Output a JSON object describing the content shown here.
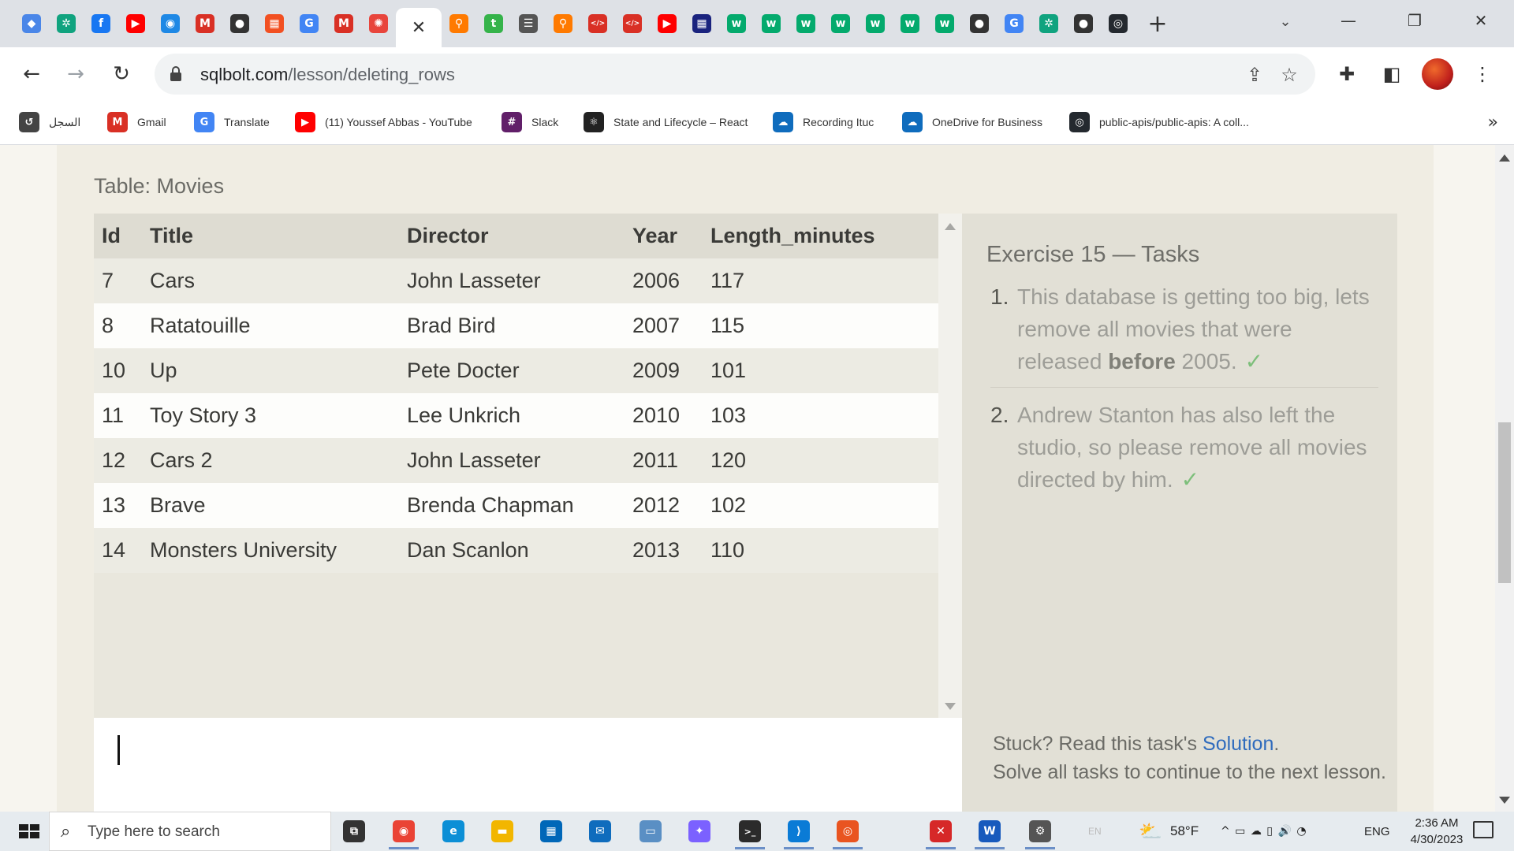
{
  "browser": {
    "tabs": [
      {
        "name": "tab-favicon-1",
        "glyph": "◆",
        "color": "#4a86e8"
      },
      {
        "name": "tab-favicon-2",
        "glyph": "✲",
        "color": "#10a37f"
      },
      {
        "name": "tab-favicon-3",
        "glyph": "f",
        "color": "#1877f2"
      },
      {
        "name": "tab-favicon-4",
        "glyph": "▶",
        "color": "#ff0000"
      },
      {
        "name": "tab-favicon-5",
        "glyph": "◉",
        "color": "#1e88e5"
      },
      {
        "name": "tab-favicon-6",
        "glyph": "M",
        "color": "#d93025"
      },
      {
        "name": "tab-favicon-7",
        "glyph": "●",
        "color": "#333333"
      },
      {
        "name": "tab-favicon-8",
        "glyph": "▦",
        "color": "#f25022"
      },
      {
        "name": "tab-favicon-9",
        "glyph": "G",
        "color": "#4285f4"
      },
      {
        "name": "tab-favicon-10",
        "glyph": "M",
        "color": "#d93025"
      },
      {
        "name": "tab-favicon-11",
        "glyph": "✺",
        "color": "#e8453c"
      },
      {
        "name": "tab-favicon-13",
        "glyph": "⚲",
        "color": "#ff7a00"
      },
      {
        "name": "tab-favicon-14",
        "glyph": "t",
        "color": "#35b34a"
      },
      {
        "name": "tab-favicon-15",
        "glyph": "☰",
        "color": "#555555"
      },
      {
        "name": "tab-favicon-16",
        "glyph": "⚲",
        "color": "#ff7a00"
      },
      {
        "name": "tab-favicon-17",
        "glyph": "</>",
        "color": "#d93025"
      },
      {
        "name": "tab-favicon-18",
        "glyph": "</>",
        "color": "#d93025"
      },
      {
        "name": "tab-favicon-19",
        "glyph": "▶",
        "color": "#ff0000"
      },
      {
        "name": "tab-favicon-20",
        "glyph": "▦",
        "color": "#1a237e"
      },
      {
        "name": "tab-favicon-21",
        "glyph": "w",
        "color": "#04aa6d"
      },
      {
        "name": "tab-favicon-22",
        "glyph": "w",
        "color": "#04aa6d"
      },
      {
        "name": "tab-favicon-23",
        "glyph": "w",
        "color": "#04aa6d"
      },
      {
        "name": "tab-favicon-24",
        "glyph": "w",
        "color": "#04aa6d"
      },
      {
        "name": "tab-favicon-25",
        "glyph": "w",
        "color": "#04aa6d"
      },
      {
        "name": "tab-favicon-26",
        "glyph": "w",
        "color": "#04aa6d"
      },
      {
        "name": "tab-favicon-27",
        "glyph": "w",
        "color": "#04aa6d"
      },
      {
        "name": "tab-favicon-28",
        "glyph": "●",
        "color": "#333333"
      },
      {
        "name": "tab-favicon-29",
        "glyph": "G",
        "color": "#4285f4"
      },
      {
        "name": "tab-favicon-30",
        "glyph": "✲",
        "color": "#10a37f"
      },
      {
        "name": "tab-favicon-31",
        "glyph": "●",
        "color": "#333333"
      },
      {
        "name": "tab-favicon-32",
        "glyph": "◎",
        "color": "#24292f"
      }
    ],
    "active_tab_close": "✕",
    "new_tab": "+",
    "tab_search": "⌄",
    "window": {
      "minimize": "—",
      "restore": "❐",
      "close": "✕"
    },
    "nav": {
      "back": "←",
      "forward": "→",
      "reload": "↻"
    },
    "url_host": "sqlbolt.com",
    "url_path": "/lesson/deleting_rows",
    "omnibox_icons": {
      "share": "⇪",
      "star": "☆"
    },
    "toolbar_icons": {
      "extensions": "✚",
      "sidepanel": "◧",
      "menu": "⋮"
    },
    "bookmarks": [
      {
        "label": "السجل",
        "glyph": "↺",
        "color": "#444444"
      },
      {
        "label": "Gmail",
        "glyph": "M",
        "color": "#d93025"
      },
      {
        "label": "Translate",
        "glyph": "G",
        "color": "#4285f4"
      },
      {
        "label": "(11) Youssef Abbas - YouTube",
        "glyph": "▶",
        "color": "#ff0000"
      },
      {
        "label": "Slack",
        "glyph": "#",
        "color": "#611f69"
      },
      {
        "label": "State and Lifecycle – React",
        "glyph": "⚛",
        "color": "#222222"
      },
      {
        "label": "Recording Ituc",
        "glyph": "☁",
        "color": "#0f6cbd"
      },
      {
        "label": "OneDrive for Business",
        "glyph": "☁",
        "color": "#0f6cbd"
      },
      {
        "label": "public-apis/public-apis: A coll...",
        "glyph": "◎",
        "color": "#24292f"
      }
    ],
    "bookmarks_more": "»"
  },
  "page": {
    "table_caption": "Table: Movies",
    "columns": [
      "Id",
      "Title",
      "Director",
      "Year",
      "Length_minutes"
    ],
    "rows": [
      [
        "7",
        "Cars",
        "John Lasseter",
        "2006",
        "117"
      ],
      [
        "8",
        "Ratatouille",
        "Brad Bird",
        "2007",
        "115"
      ],
      [
        "10",
        "Up",
        "Pete Docter",
        "2009",
        "101"
      ],
      [
        "11",
        "Toy Story 3",
        "Lee Unkrich",
        "2010",
        "103"
      ],
      [
        "12",
        "Cars 2",
        "John Lasseter",
        "2011",
        "120"
      ],
      [
        "13",
        "Brave",
        "Brenda Chapman",
        "2012",
        "102"
      ],
      [
        "14",
        "Monsters University",
        "Dan Scanlon",
        "2013",
        "110"
      ]
    ],
    "task_heading": "Exercise 15 — Tasks",
    "tasks": [
      {
        "num": "1.",
        "before": "This database is getting too big, lets remove all movies that were released ",
        "bold": "before",
        "after": " 2005.",
        "check": "✓"
      },
      {
        "num": "2.",
        "before": "Andrew Stanton has also left the studio, so please remove all movies directed by him.",
        "bold": "",
        "after": "",
        "check": "✓"
      }
    ],
    "stuck_prefix": "Stuck? Read this task's ",
    "stuck_link": "Solution",
    "stuck_suffix": ".",
    "stuck_line2": "Solve all tasks to continue to the next lesson."
  },
  "taskbar": {
    "search_placeholder": "Type here to search",
    "search_icon": "⌕",
    "apps": [
      {
        "name": "task-view",
        "glyph": "⧉",
        "color": "#333333",
        "ul": false
      },
      {
        "name": "chrome",
        "glyph": "◉",
        "color": "#ea4335",
        "ul": true
      },
      {
        "name": "edge",
        "glyph": "e",
        "color": "#0c8fd6",
        "ul": false
      },
      {
        "name": "file-explorer",
        "glyph": "▬",
        "color": "#f2b600",
        "ul": false
      },
      {
        "name": "microsoft-store",
        "glyph": "▦",
        "color": "#0067b8",
        "ul": false
      },
      {
        "name": "mail",
        "glyph": "✉",
        "color": "#0f6cbd",
        "ul": false
      },
      {
        "name": "pc-app",
        "glyph": "▭",
        "color": "#5a8fc4",
        "ul": false
      },
      {
        "name": "onenote-app",
        "glyph": "✦",
        "color": "#7b61ff",
        "ul": false
      },
      {
        "name": "terminal",
        "glyph": ">_",
        "color": "#2b2b2b",
        "ul": true
      },
      {
        "name": "vscode",
        "glyph": "⟩",
        "color": "#0a7bd6",
        "ul": true
      },
      {
        "name": "ubuntu",
        "glyph": "◎",
        "color": "#e95420",
        "ul": true
      },
      {
        "name": "pdf-reader",
        "glyph": "✕",
        "color": "#d62828",
        "ul": true
      },
      {
        "name": "word",
        "glyph": "W",
        "color": "#185abd",
        "ul": true
      },
      {
        "name": "settings",
        "glyph": "⚙",
        "color": "#555555",
        "ul": true
      }
    ],
    "lang_faint": "EN",
    "weather": "58°F",
    "weather_icon": "⛅",
    "tray_icons": "^  ▭  ☁  ▯  🔊  ◔",
    "language": "ENG",
    "time": "2:36 AM",
    "date": "4/30/2023"
  }
}
